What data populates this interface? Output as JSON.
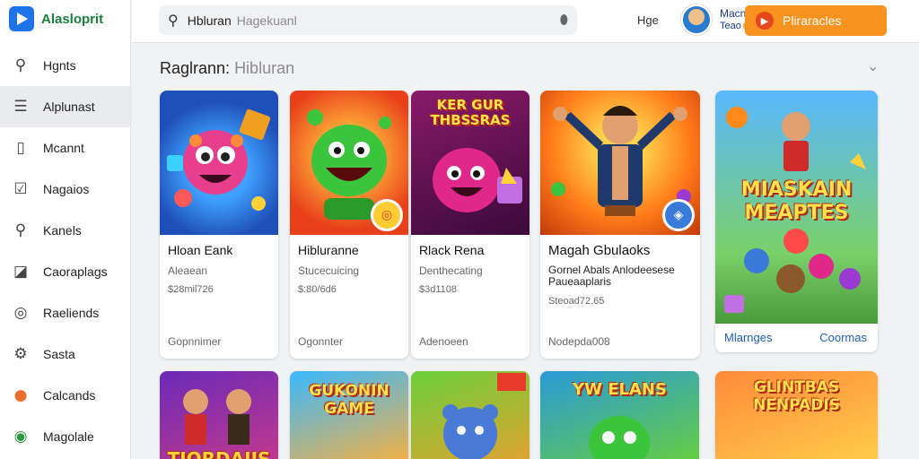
{
  "app": {
    "name": "Alasloprit"
  },
  "sidebar": {
    "items": [
      {
        "label": "Hgnts",
        "icon": "filter-icon"
      },
      {
        "label": "Alplunast",
        "icon": "list-icon"
      },
      {
        "label": "Mcannt",
        "icon": "info-icon"
      },
      {
        "label": "Nagaios",
        "icon": "checkbox-icon"
      },
      {
        "label": "Kanels",
        "icon": "search-icon"
      },
      {
        "label": "Caoraplags",
        "icon": "chart-icon"
      },
      {
        "label": "Raeliends",
        "icon": "dots-icon"
      },
      {
        "label": "Sasta",
        "icon": "gear-icon"
      },
      {
        "label": "Calcands",
        "icon": "globe-icon"
      },
      {
        "label": "Magolale",
        "icon": "circle-icon"
      }
    ]
  },
  "topbar": {
    "search_text": "Hbluran",
    "search_placeholder": "Hagekuanl",
    "link": "Hge",
    "user_name": "Macnes",
    "user_sub": "Teao",
    "cta_label": "Pliraracles"
  },
  "section": {
    "title": "Raglrann:",
    "subtitle": "Hibluran"
  },
  "cards": [
    {
      "name": "Hloan Eank",
      "dev": "Aleaean",
      "price": "$28mil726",
      "foot": "Gopnnimer"
    },
    {
      "name": "Hibluranne",
      "dev": "Stucecuicing",
      "price": "$:80/6d6",
      "foot": "Ogonnter"
    },
    {
      "name": "Rlack Rena",
      "dev": "Denthecating",
      "price": "$3d1108",
      "foot": "Adenoeen"
    },
    {
      "name": "Magah Gbulaoks",
      "desc": "Gornel Abals Anlodeesese Paueaaplaris",
      "price": "Steoad72.65",
      "foot": "Nodepda008"
    }
  ],
  "feature": {
    "art_text": "MIASKAIN MEAPTES",
    "left_link": "Mlarnges",
    "right_link": "Coormas"
  },
  "art": {
    "card3_title": "KER GUR THBSSRAS",
    "row2": [
      {
        "title": "TIORDAIIS"
      },
      {
        "title": "GUKONIN GAME"
      },
      {
        "title": ""
      },
      {
        "title": "YW ELANS"
      },
      {
        "title": "GLINTBAS NENPADIS"
      }
    ]
  },
  "colors": {
    "accent": "#f7931e",
    "brand": "#1e73e8",
    "link": "#1f5fb8"
  }
}
